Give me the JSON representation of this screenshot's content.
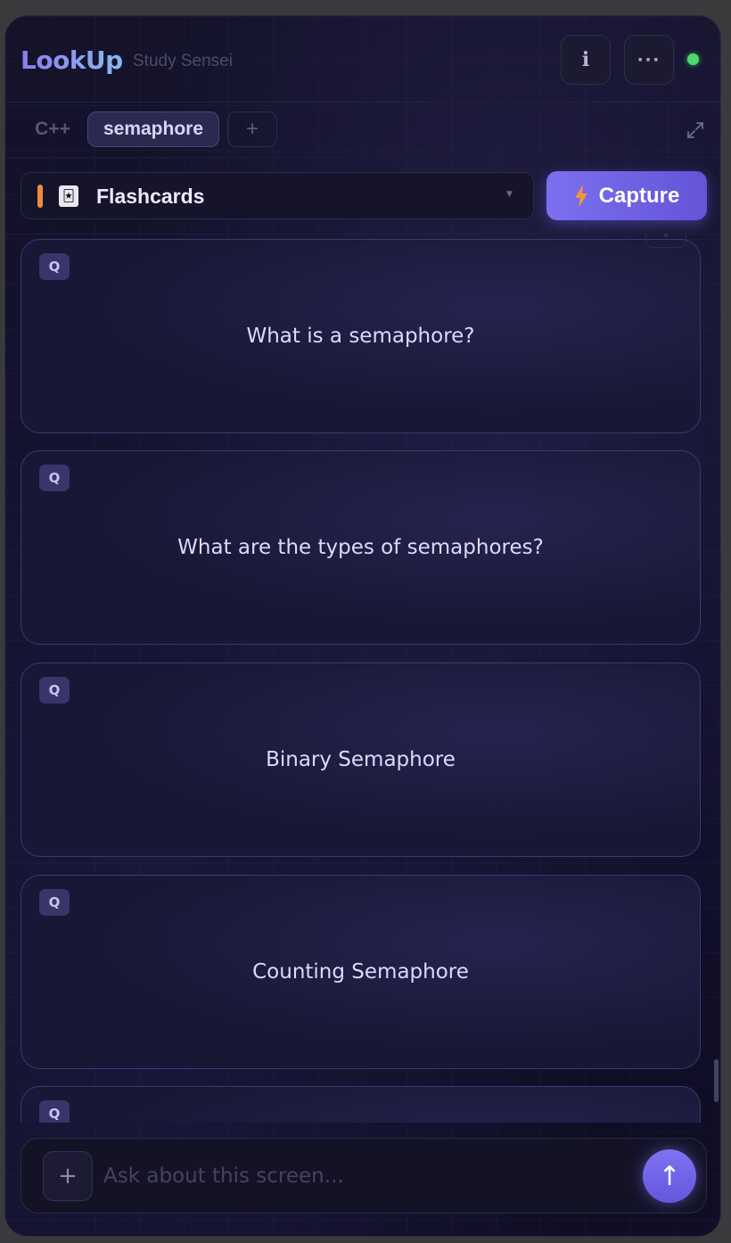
{
  "header": {
    "logo": "LookUp",
    "subtitle": "Study Sensei",
    "info_label": "i",
    "more_label": "···",
    "status_color": "#4cd96e"
  },
  "tabs": {
    "items": [
      {
        "label": "C++",
        "active": false
      },
      {
        "label": "semaphore",
        "active": true
      }
    ],
    "add_label": "+",
    "expand_icon": "expand-icon"
  },
  "mode": {
    "label": "Flashcards",
    "icon": "playing-card-icon",
    "accent_color": "#f08a3c"
  },
  "capture": {
    "label": "Capture",
    "icon": "lightning-bolt-icon"
  },
  "cards": [
    {
      "badge": "Q",
      "text": "What is a semaphore?"
    },
    {
      "badge": "Q",
      "text": "What are the types of semaphores?"
    },
    {
      "badge": "Q",
      "text": "Binary Semaphore"
    },
    {
      "badge": "Q",
      "text": "Counting Semaphore"
    },
    {
      "badge": "Q",
      "text": ""
    }
  ],
  "input": {
    "placeholder": "Ask about this screen...",
    "value": "",
    "attach_label": "+",
    "send_label": "↑"
  },
  "colors": {
    "accent": "#7c6ff0",
    "background": "#11102a"
  }
}
